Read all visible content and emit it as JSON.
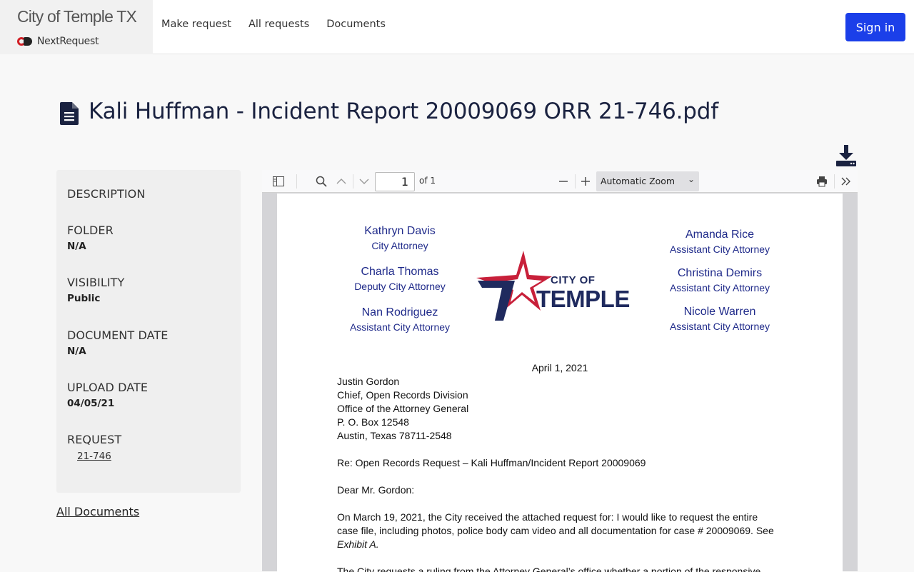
{
  "header": {
    "brand_title": "City of Temple TX",
    "brand_sub": "NextRequest",
    "nav": [
      "Make request",
      "All requests",
      "Documents"
    ],
    "signin": "Sign in"
  },
  "document": {
    "title": "Kali Huffman - Incident Report 20009069 ORR 21-746.pdf",
    "icon": "file-text-icon"
  },
  "sidebar": {
    "description_label": "DESCRIPTION",
    "folder_label": "FOLDER",
    "folder_value": "N/A",
    "visibility_label": "VISIBILITY",
    "visibility_value": "Public",
    "document_date_label": "DOCUMENT DATE",
    "document_date_value": "N/A",
    "upload_date_label": "UPLOAD DATE",
    "upload_date_value": "04/05/21",
    "request_label": "REQUEST",
    "request_value": "21-746",
    "all_documents": "All Documents"
  },
  "viewer": {
    "page_number": "1",
    "page_of": "of 1",
    "zoom": "Automatic Zoom"
  },
  "pdf": {
    "attorneys_left": [
      {
        "name": "Kathryn Davis",
        "role": "City Attorney"
      },
      {
        "name": "Charla Thomas",
        "role": "Deputy City Attorney"
      },
      {
        "name": "Nan Rodriguez",
        "role": "Assistant City Attorney"
      }
    ],
    "attorneys_right": [
      {
        "name": "Amanda Rice",
        "role": "Assistant City Attorney"
      },
      {
        "name": "Christina Demirs",
        "role": "Assistant City Attorney"
      },
      {
        "name": "Nicole Warren",
        "role": "Assistant City Attorney"
      }
    ],
    "logo_city": "CITY OF",
    "logo_temple": "TEMPLE",
    "date": "April 1, 2021",
    "address": [
      "Justin Gordon",
      "Chief, Open Records Division",
      "Office of the Attorney General",
      "P. O. Box 12548",
      "Austin, Texas 78711-2548"
    ],
    "re": "Re: Open Records Request – Kali Huffman/Incident Report 20009069",
    "salutation": "Dear Mr. Gordon:",
    "para1_line1": "On March 19, 2021, the City received the attached request for: I would like to request the entire",
    "para1_line2": "case file, including photos, police body cam video and all documentation for case # 20009069. See",
    "para1_line3": "Exhibit A.",
    "para2_line1": "The City requests a ruling from the Attorney General’s office whether a portion of the responsive"
  },
  "colors": {
    "primary_button": "#1b3fe9",
    "title_text": "#1a2240",
    "logo_red": "#c8203a",
    "logo_navy": "#1f2a5e",
    "attorney_blue": "#1f2a8a"
  }
}
